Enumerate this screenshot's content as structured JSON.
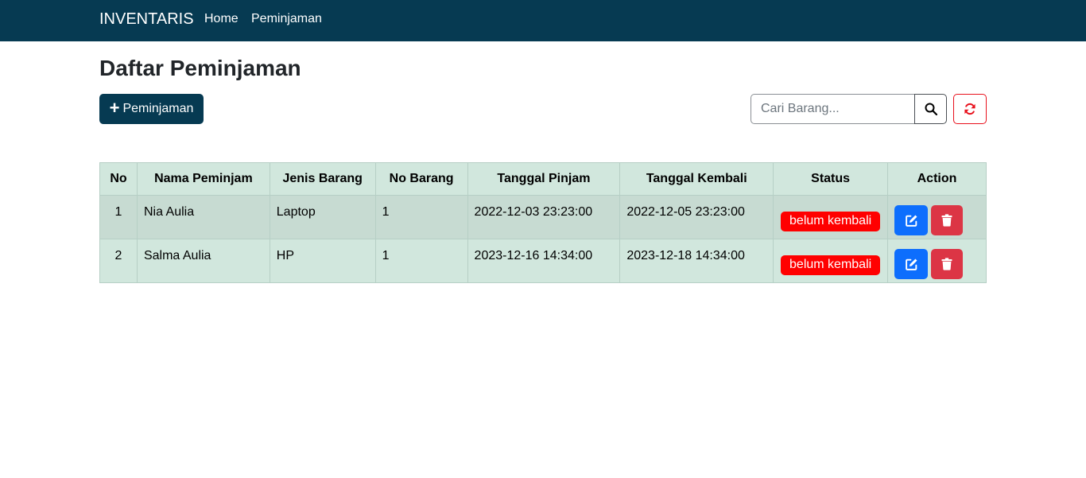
{
  "navbar": {
    "brand": "INVENTARIS",
    "links": [
      "Home",
      "Peminjaman"
    ]
  },
  "page": {
    "title": "Daftar Peminjaman",
    "add_button_label": "Peminjaman",
    "search_placeholder": "Cari Barang..."
  },
  "table": {
    "headers": [
      "No",
      "Nama Peminjam",
      "Jenis Barang",
      "No Barang",
      "Tanggal Pinjam",
      "Tanggal Kembali",
      "Status",
      "Action"
    ],
    "rows": [
      {
        "no": "1",
        "nama": "Nia Aulia",
        "jenis": "Laptop",
        "no_barang": "1",
        "tanggal_pinjam": "2022-12-03 23:23:00",
        "tanggal_kembali": "2022-12-05 23:23:00",
        "status": "belum kembali"
      },
      {
        "no": "2",
        "nama": "Salma Aulia",
        "jenis": "HP",
        "no_barang": "1",
        "tanggal_pinjam": "2023-12-16 14:34:00",
        "tanggal_kembali": "2023-12-18 14:34:00",
        "status": "belum kembali"
      }
    ]
  },
  "icons": {
    "add": "plus-icon",
    "search": "search-icon",
    "refresh": "refresh-icon",
    "edit": "edit-icon",
    "delete": "trash-icon"
  },
  "colors": {
    "navbar": "#063a52",
    "table_header": "#d1e7dd",
    "status_badge": "#ff0000",
    "edit_button": "#0d6efd",
    "delete_button": "#dc3545",
    "refresh_border": "#e8101c"
  }
}
